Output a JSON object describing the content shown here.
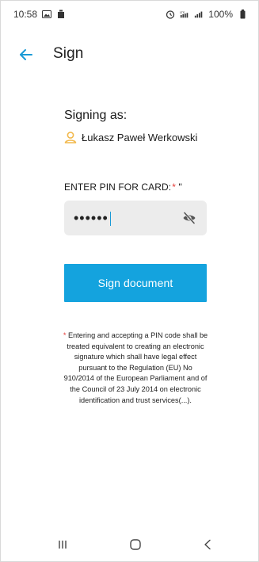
{
  "status_bar": {
    "time": "10:58",
    "battery": "100%",
    "left_icons": [
      "gallery-icon",
      "notification-card-icon"
    ],
    "right_icons": [
      "alarm-icon",
      "lte-signal-icon",
      "signal-bars-icon",
      "battery-icon"
    ]
  },
  "app_bar": {
    "title": "Sign",
    "back_icon": "arrow-left-icon"
  },
  "content": {
    "signing_as_label": "Signing as:",
    "signer_name": "Łukasz Paweł Werkowski",
    "pin_label": "ENTER PIN FOR CARD:",
    "required_mark": "*",
    "pin_label_suffix": " \"",
    "pin_value": "••••••",
    "sign_button_label": "Sign document",
    "disclaimer_star": "*",
    "disclaimer_text": " Entering and accepting a PIN code shall be treated equivalent to creating an electronic signature which shall have legal effect pursuant to the Regulation (EU) No 910/2014 of the European Parliament and of the Council of 23 July 2014 on electronic identification and trust services(...)."
  },
  "colors": {
    "accent": "#14a3de",
    "back_arrow": "#1a9ad6",
    "required": "#e53935",
    "person_icon": "#f2b84b",
    "field_bg": "#ececec"
  },
  "nav_bar": {
    "buttons": [
      "recent-apps-icon",
      "home-icon",
      "back-nav-icon"
    ]
  }
}
